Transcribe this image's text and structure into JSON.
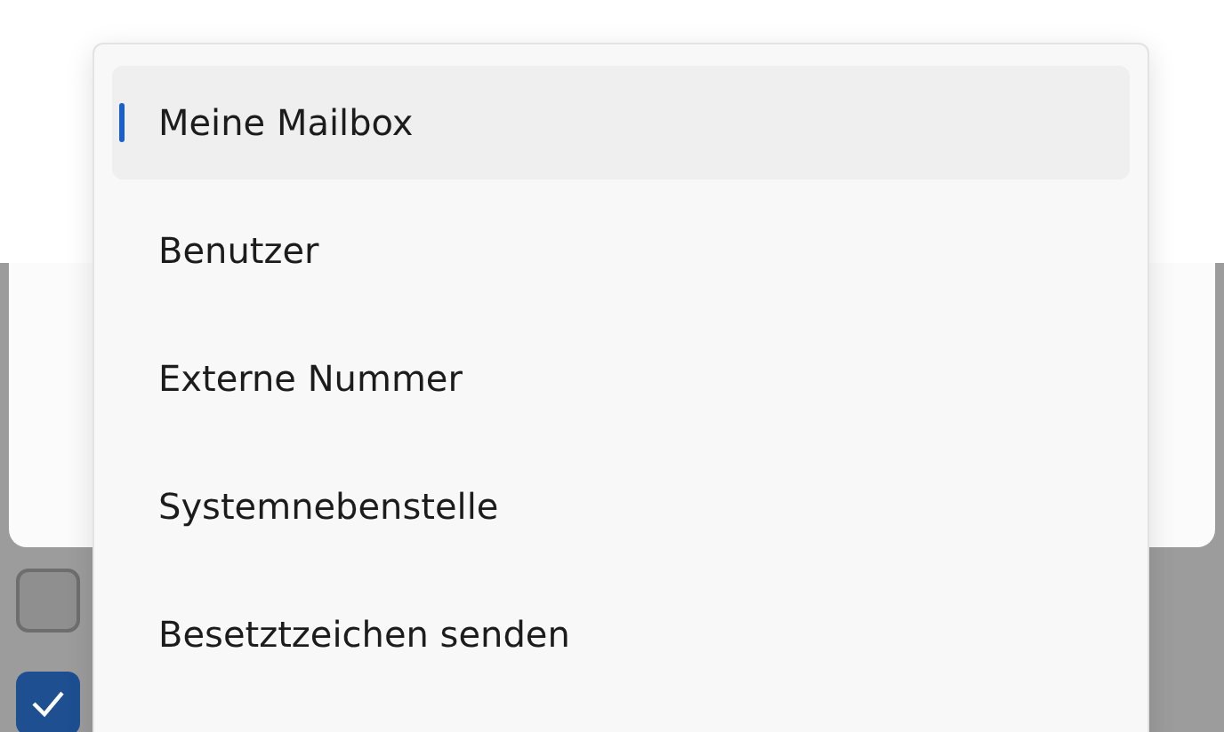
{
  "menu": {
    "items": [
      {
        "label": "Meine Mailbox",
        "selected": true
      },
      {
        "label": "Benutzer",
        "selected": false
      },
      {
        "label": "Externe Nummer",
        "selected": false
      },
      {
        "label": "Systemnebenstelle",
        "selected": false
      },
      {
        "label": "Besetztzeichen senden",
        "selected": false
      }
    ]
  },
  "checkboxes": [
    {
      "checked": false
    },
    {
      "checked": true
    }
  ]
}
